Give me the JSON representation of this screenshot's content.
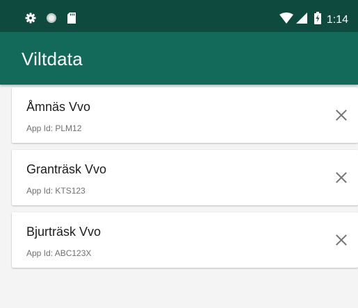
{
  "status_bar": {
    "time": "1:14",
    "icons": [
      "settings-icon",
      "circle-icon",
      "sd-card-icon",
      "wifi-icon",
      "signal-icon",
      "battery-charging-icon"
    ]
  },
  "app_bar": {
    "title": "Viltdata"
  },
  "items": [
    {
      "name": "Åmnäs Vvo",
      "app_id": "App Id: PLM12"
    },
    {
      "name": "Granträsk Vvo",
      "app_id": "App Id: KTS123"
    },
    {
      "name": "Bjurträsk Vvo",
      "app_id": "App Id: ABC123X"
    }
  ],
  "colors": {
    "status_bar": "#0e4a3d",
    "app_bar": "#146a5a",
    "background": "#f4f4f4"
  }
}
